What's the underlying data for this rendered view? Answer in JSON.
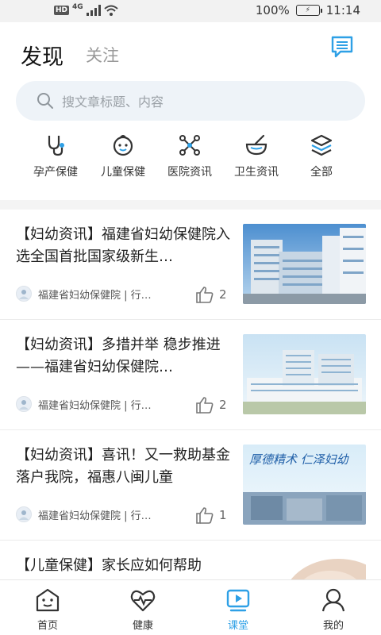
{
  "status_bar": {
    "hd": "HD",
    "network": "4G",
    "battery": "100%",
    "time": "11:14"
  },
  "header": {
    "tab_discover": "发现",
    "tab_follow": "关注",
    "message_icon": "message-list-icon"
  },
  "search": {
    "placeholder": "搜文章标题、内容",
    "icon": "search-icon"
  },
  "categories": [
    {
      "label": "孕产保健",
      "icon": "stethoscope-icon"
    },
    {
      "label": "儿童保健",
      "icon": "baby-face-icon"
    },
    {
      "label": "医院资讯",
      "icon": "network-nodes-icon"
    },
    {
      "label": "卫生资讯",
      "icon": "mortar-bowl-icon"
    },
    {
      "label": "全部",
      "icon": "layers-icon"
    }
  ],
  "articles": [
    {
      "title": "【妇幼资讯】福建省妇幼保健院入选全国首批国家级新生…",
      "source": "福建省妇幼保健院 | 行…",
      "likes": "2",
      "thumb_desc": "hospital-building-photo"
    },
    {
      "title": "【妇幼资讯】多措并举 稳步推进——福建省妇幼保健院…",
      "source": "福建省妇幼保健院 | 行…",
      "likes": "2",
      "thumb_desc": "hospital-campus-rendering"
    },
    {
      "title": "【妇幼资讯】喜讯！又一救助基金落户我院，福惠八闽儿童",
      "source": "福建省妇幼保健院 | 行…",
      "likes": "1",
      "thumb_desc": "calligraphy-hospital-photo",
      "thumb_text": "厚德精术 仁泽妇幼"
    },
    {
      "title": "【儿童保健】家长应如何帮助",
      "thumb_desc": "child-photo"
    }
  ],
  "bottom_nav": [
    {
      "label": "首页",
      "icon": "home-face-icon",
      "active": false
    },
    {
      "label": "健康",
      "icon": "heart-pulse-icon",
      "active": false
    },
    {
      "label": "课堂",
      "icon": "video-play-icon",
      "active": true
    },
    {
      "label": "我的",
      "icon": "user-icon",
      "active": false
    }
  ],
  "colors": {
    "accent": "#2ea0e6",
    "icon_dark": "#333333",
    "search_bg": "#eef3f8"
  }
}
